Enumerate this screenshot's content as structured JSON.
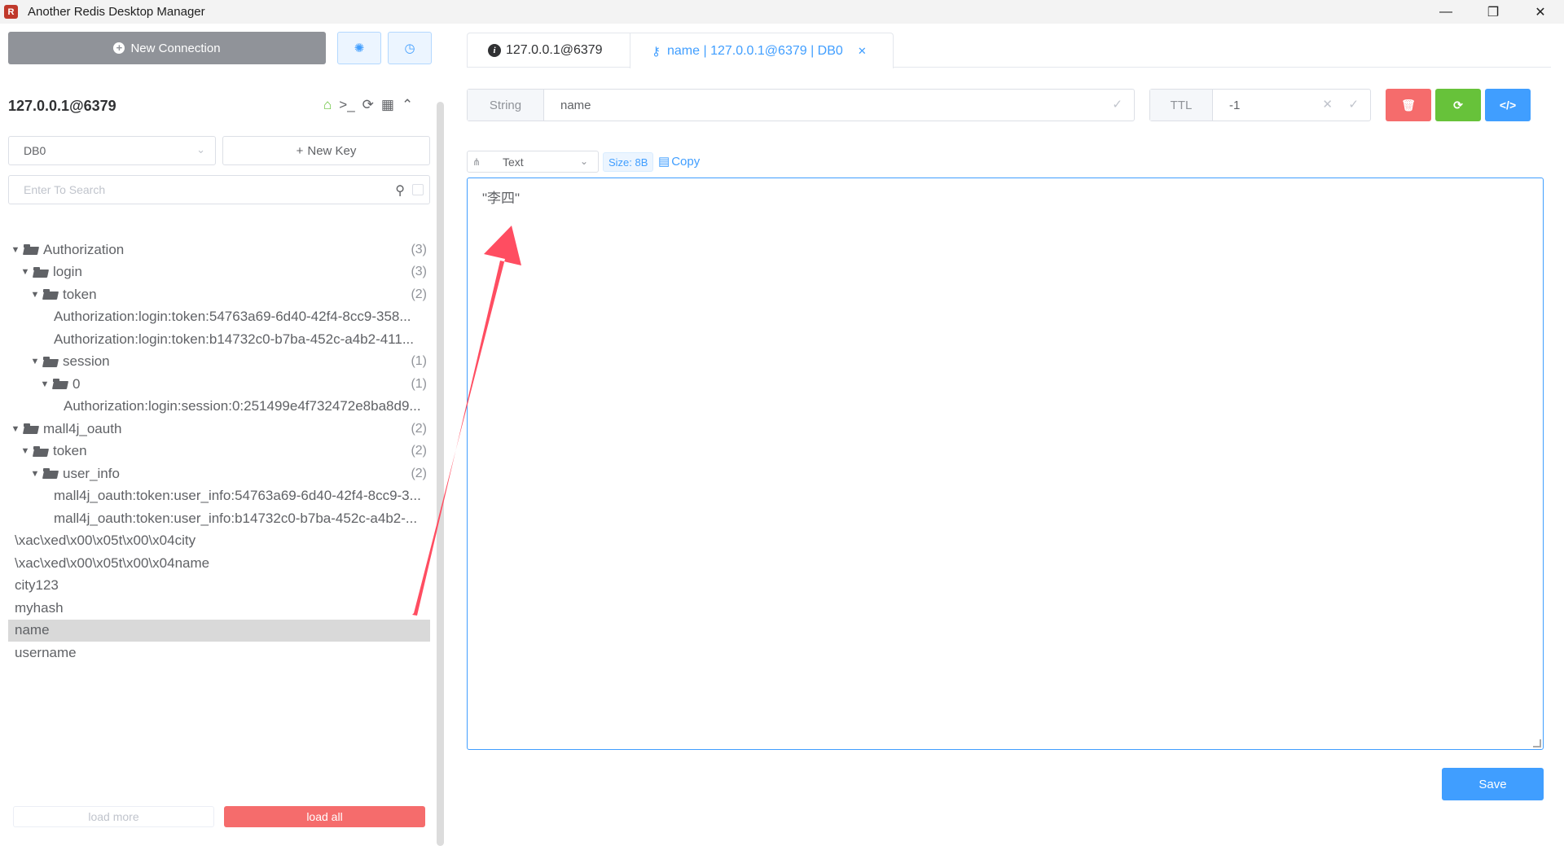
{
  "window": {
    "title": "Another Redis Desktop Manager",
    "logo_glyph": "R",
    "controls": {
      "minimize": "—",
      "restore": "❐",
      "close": "✕"
    }
  },
  "sidebar": {
    "new_connection_label": "New Connection",
    "connection_name": "127.0.0.1@6379",
    "db_select": {
      "selected": "DB0"
    },
    "new_key_label": "New Key",
    "search": {
      "placeholder": "Enter To Search",
      "value": ""
    },
    "tree": [
      {
        "label": "Authorization",
        "count": "(3)",
        "depth": 0,
        "folder": true
      },
      {
        "label": "login",
        "count": "(3)",
        "depth": 1,
        "folder": true
      },
      {
        "label": "token",
        "count": "(2)",
        "depth": 2,
        "folder": true
      },
      {
        "label": "Authorization:login:token:54763a69-6d40-42f4-8cc9-358...",
        "count": "",
        "depth": 3,
        "folder": false
      },
      {
        "label": "Authorization:login:token:b14732c0-b7ba-452c-a4b2-411...",
        "count": "",
        "depth": 3,
        "folder": false
      },
      {
        "label": "session",
        "count": "(1)",
        "depth": 2,
        "folder": true
      },
      {
        "label": "0",
        "count": "(1)",
        "depth": 3,
        "folder": true
      },
      {
        "label": "Authorization:login:session:0:251499e4f732472e8ba8d9...",
        "count": "",
        "depth": 4,
        "folder": false
      },
      {
        "label": "mall4j_oauth",
        "count": "(2)",
        "depth": 0,
        "folder": true
      },
      {
        "label": "token",
        "count": "(2)",
        "depth": 1,
        "folder": true
      },
      {
        "label": "user_info",
        "count": "(2)",
        "depth": 2,
        "folder": true
      },
      {
        "label": "mall4j_oauth:token:user_info:54763a69-6d40-42f4-8cc9-3...",
        "count": "",
        "depth": 3,
        "folder": false
      },
      {
        "label": "mall4j_oauth:token:user_info:b14732c0-b7ba-452c-a4b2-...",
        "count": "",
        "depth": 3,
        "folder": false
      },
      {
        "label": "\\xac\\xed\\x00\\x05t\\x00\\x04city",
        "count": "",
        "depth": 0,
        "folder": false,
        "leaf_root": true
      },
      {
        "label": "\\xac\\xed\\x00\\x05t\\x00\\x04name",
        "count": "",
        "depth": 0,
        "folder": false,
        "leaf_root": true
      },
      {
        "label": "city123",
        "count": "",
        "depth": 0,
        "folder": false,
        "leaf_root": true
      },
      {
        "label": "myhash",
        "count": "",
        "depth": 0,
        "folder": false,
        "leaf_root": true
      },
      {
        "label": "name",
        "count": "",
        "depth": 0,
        "folder": false,
        "leaf_root": true,
        "selected": true
      },
      {
        "label": "username",
        "count": "",
        "depth": 0,
        "folder": false,
        "leaf_root": true
      }
    ],
    "load_more_label": "load more",
    "load_all_label": "load all"
  },
  "tabs": [
    {
      "label": "127.0.0.1@6379",
      "icon": "info-icon",
      "active": false
    },
    {
      "label": "name | 127.0.0.1@6379 | DB0",
      "icon": "key-icon",
      "active": true
    }
  ],
  "key_panel": {
    "type_label": "String",
    "key_name": "name",
    "ttl_label": "TTL",
    "ttl_value": "-1",
    "format": "Text",
    "size_label": "Size: 8B",
    "copy_label": "Copy",
    "value": "\"李四\"",
    "save_label": "Save"
  },
  "colors": {
    "accent": "#409eff",
    "danger": "#f56c6c",
    "success": "#67c23a",
    "annotation_arrow": "#ff4d61"
  }
}
